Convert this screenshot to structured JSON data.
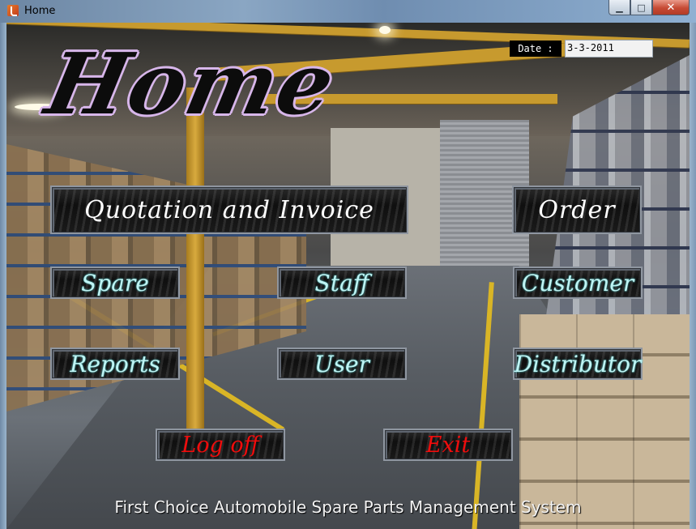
{
  "window": {
    "title": "Home",
    "controls": {
      "minimize": "▁",
      "maximize": "□",
      "close": "✕"
    }
  },
  "header": {
    "home_title": "Home",
    "date_label": "Date :",
    "date_value": "3-3-2011"
  },
  "buttons": {
    "quotation": "Quotation and Invoice",
    "order": "Order",
    "spare": "Spare",
    "staff": "Staff",
    "customer": "Customer",
    "reports": "Reports",
    "user": "User",
    "distributor": "Distributor",
    "logoff": "Log off",
    "exit": "Exit"
  },
  "footer": {
    "caption": "First Choice Automobile Spare Parts Management System"
  },
  "colors": {
    "button_bg": "#111111",
    "button_border": "#8f96a0",
    "cyan_text": "#bff4f4",
    "red_text": "#f00c0c",
    "title_outline": "#d7b6ea"
  }
}
